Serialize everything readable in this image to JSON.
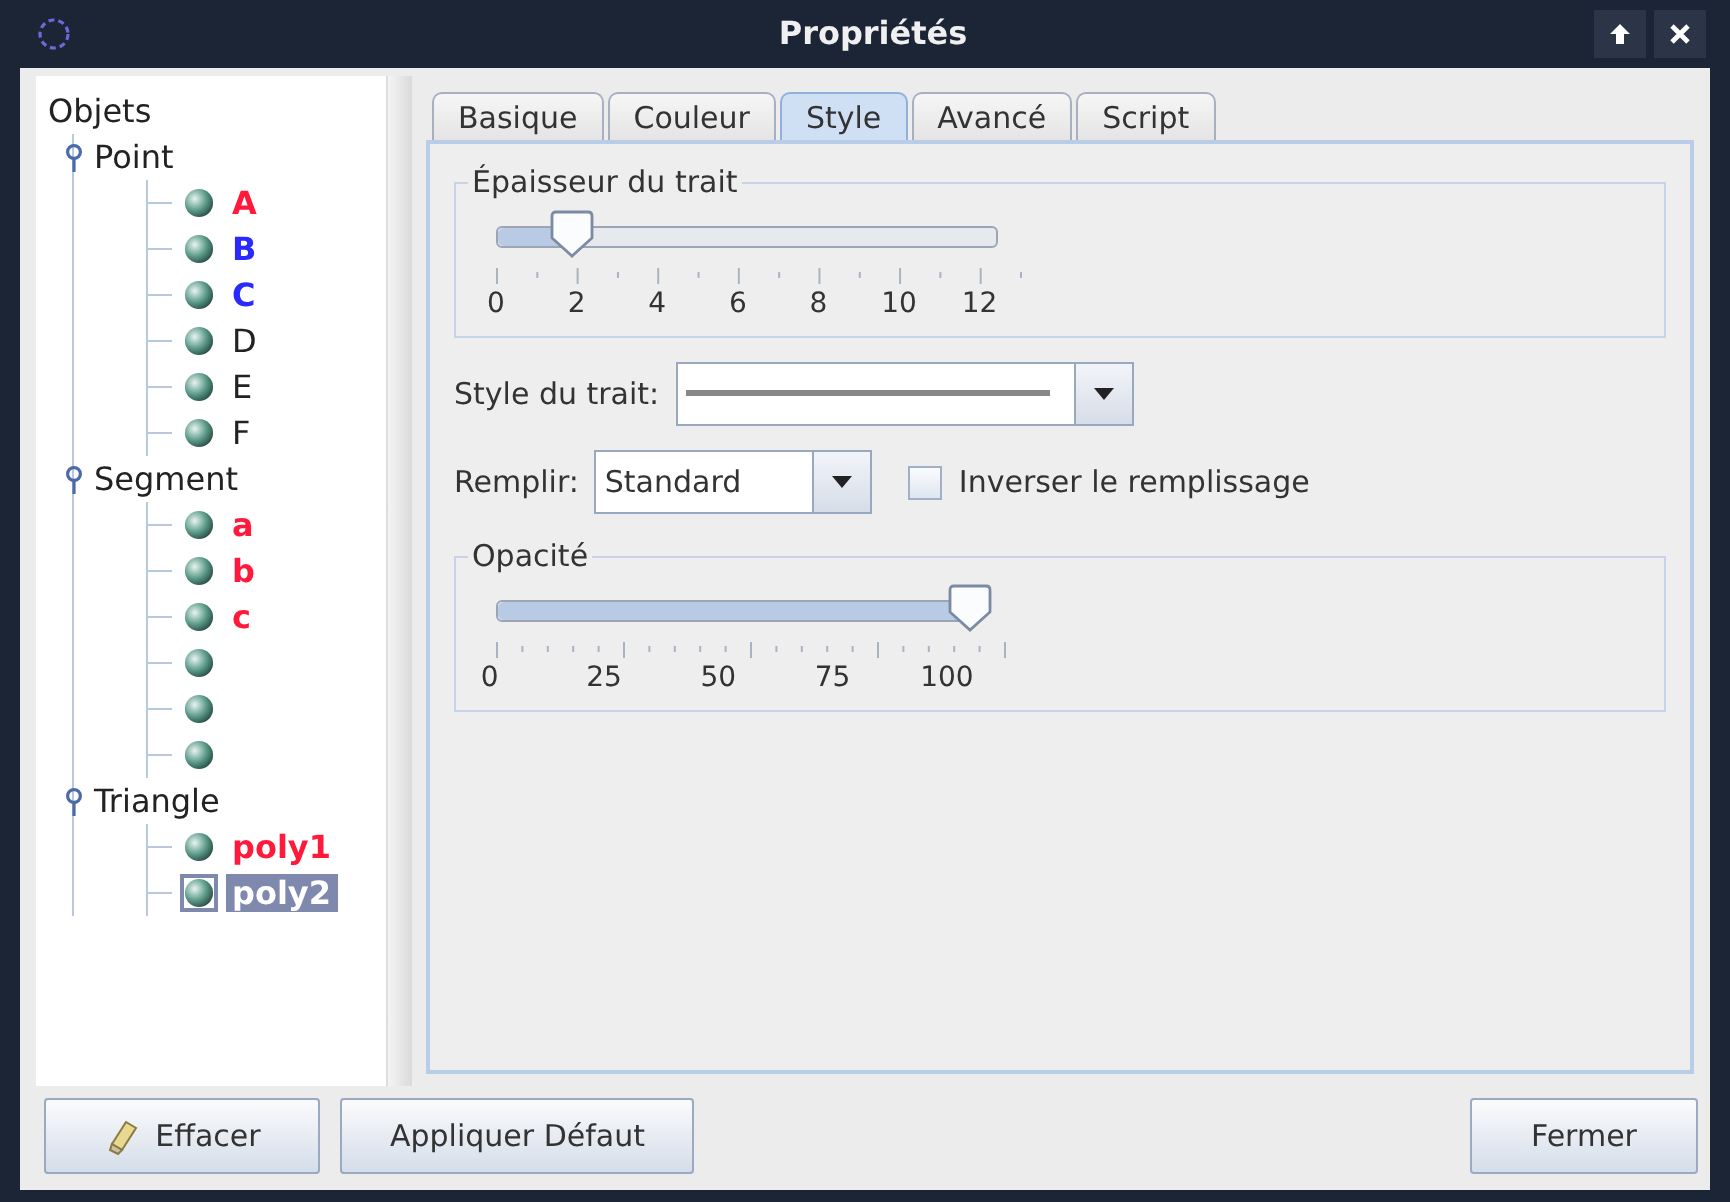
{
  "window": {
    "title": "Propriétés"
  },
  "tree": {
    "label": "Objets",
    "children": [
      {
        "label": "Point",
        "expanded": true,
        "children": [
          {
            "label": "A",
            "color": "#ff1a3c",
            "selected": false
          },
          {
            "label": "B",
            "color": "#2a2aff",
            "selected": false
          },
          {
            "label": "C",
            "color": "#2a2aff",
            "selected": false
          },
          {
            "label": "D",
            "selected": false
          },
          {
            "label": "E",
            "selected": false
          },
          {
            "label": "F",
            "selected": false
          }
        ]
      },
      {
        "label": "Segment",
        "expanded": true,
        "children": [
          {
            "label": "a",
            "color": "#ff1a3c",
            "selected": false
          },
          {
            "label": "b",
            "color": "#ff1a3c",
            "selected": false
          },
          {
            "label": "c",
            "color": "#ff1a3c",
            "selected": false
          },
          {
            "selected": false
          },
          {
            "selected": false
          },
          {
            "selected": false
          }
        ]
      },
      {
        "label": "Triangle",
        "expanded": true,
        "children": [
          {
            "label": "poly1",
            "color": "#ff1a3c",
            "selected": false
          },
          {
            "label": "poly2",
            "selected": true
          }
        ]
      }
    ]
  },
  "tabs": [
    {
      "label": "Basique",
      "selected": false
    },
    {
      "label": "Couleur",
      "selected": false
    },
    {
      "label": "Style",
      "selected": true
    },
    {
      "label": "Avancé",
      "selected": false
    },
    {
      "label": "Script",
      "selected": false
    }
  ],
  "thickness": {
    "legend": "Épaisseur du trait",
    "level": 0.15,
    "tick_labels": [
      "0",
      "2",
      "4",
      "6",
      "8",
      "10",
      "12"
    ]
  },
  "line_style": {
    "label": "Style du trait:"
  },
  "fill": {
    "label": "Remplir:",
    "value": "Standard"
  },
  "invert_fill": {
    "label": "Inverser le remplissage",
    "checked": false
  },
  "opacity": {
    "legend": "Opacité",
    "level": 0.98,
    "tick_labels": [
      "0",
      "25",
      "50",
      "75",
      "100"
    ]
  },
  "buttons": [
    {
      "label": "Effacer",
      "kind": "eraser"
    },
    {
      "label": "Appliquer Défaut",
      "kind": "plain"
    },
    {
      "label": "Fermer",
      "kind": "plain"
    }
  ]
}
